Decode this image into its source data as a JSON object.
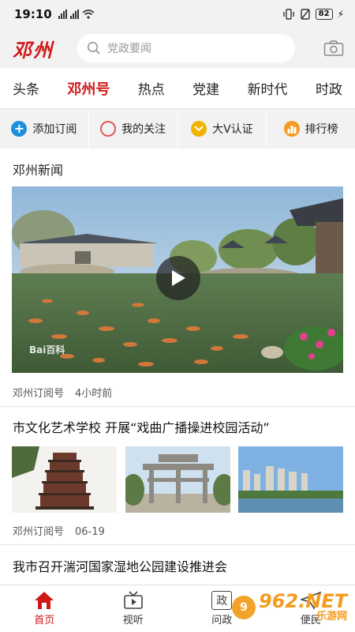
{
  "status_bar": {
    "time": "19:10",
    "left_icons": "4G 4G",
    "battery": "82"
  },
  "header": {
    "logo": "邓州",
    "search_placeholder": "党政要闻"
  },
  "tabs": [
    {
      "label": "头条",
      "active": false
    },
    {
      "label": "邓州号",
      "active": true
    },
    {
      "label": "热点",
      "active": false
    },
    {
      "label": "党建",
      "active": false
    },
    {
      "label": "新时代",
      "active": false
    },
    {
      "label": "时政",
      "active": false
    }
  ],
  "quick_actions": [
    {
      "label": "添加订阅",
      "icon": "plus-circle-icon",
      "color": "#1d8fdc"
    },
    {
      "label": "我的关注",
      "icon": "ring-icon",
      "color": "#e05a5a"
    },
    {
      "label": "大V认证",
      "icon": "chevron-down-circle-icon",
      "color": "#f2b200"
    },
    {
      "label": "排行榜",
      "icon": "bar-chart-icon",
      "color": "#f59a23"
    }
  ],
  "section_title": "邓州新闻",
  "articles": [
    {
      "source": "邓州订阅号",
      "time": "4小时前",
      "image_watermark": "Bai百科"
    },
    {
      "title": "市文化艺术学校 开展“戏曲广播操进校园活动”",
      "source": "邓州订阅号",
      "time": "06-19"
    },
    {
      "title": "我市召开湍河国家湿地公园建设推进会"
    }
  ],
  "bottom_nav": [
    {
      "label": "首页",
      "icon": "home-icon",
      "active": true
    },
    {
      "label": "视听",
      "icon": "tv-icon",
      "active": false
    },
    {
      "label": "问政",
      "icon": "wenzheng-icon",
      "icon_text": "政",
      "active": false
    },
    {
      "label": "便民",
      "icon": "send-icon",
      "active": false
    }
  ],
  "watermark": {
    "brand": "962.NET",
    "sub": "乐游网"
  },
  "colors": {
    "brand_red": "#d01818",
    "bg_gray": "#f2f2f2"
  }
}
